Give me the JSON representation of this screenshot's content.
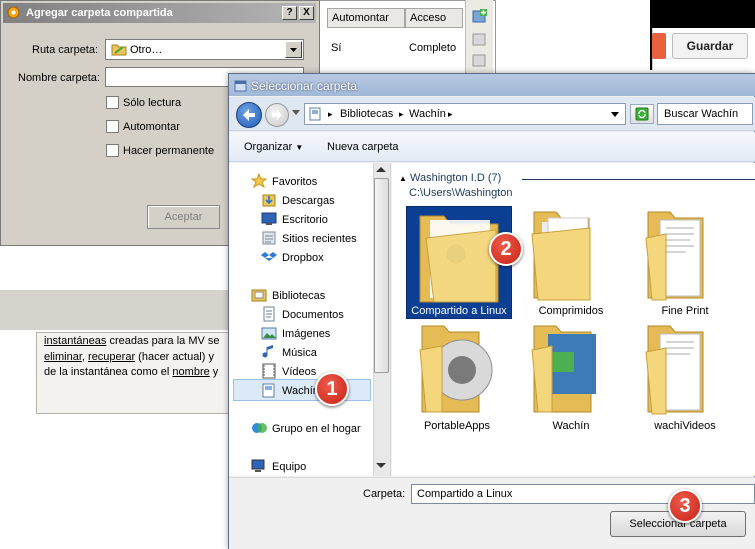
{
  "background": {
    "guardar_label": "Guardar",
    "grid_headers": [
      "Automontar",
      "Acceso"
    ],
    "grid_row": {
      "automontar": "Sí",
      "acceso": "Completo"
    },
    "panel_text": {
      "line1_link": "instantáneas",
      "line1_rest": " creadas para la MV se",
      "line2_link1": "eliminar",
      "line2_sep": ", ",
      "line2_link2": "recuperar",
      "line2_rest": " (hacer actual) y",
      "line3_pre": "de la instantánea como el ",
      "line3_link": "nombre",
      "line3_rest": " y"
    }
  },
  "dialog_agregar": {
    "title": "Agregar carpeta compartida",
    "help_btn": "?",
    "close_btn": "X",
    "ruta_label": "Ruta carpeta:",
    "ruta_value": "Otro…",
    "nombre_label": "Nombre carpeta:",
    "nombre_value": "",
    "solo_lectura": "Sólo lectura",
    "automontar": "Automontar",
    "permanente": "Hacer permanente",
    "aceptar": "Aceptar"
  },
  "dialog_select": {
    "title": "Seleccionar carpeta",
    "breadcrumb": [
      "Bibliotecas",
      "Wachín"
    ],
    "search_placeholder": "Buscar Wachín",
    "organize": "Organizar",
    "new_folder": "Nueva carpeta",
    "nav": {
      "favorites": "Favoritos",
      "downloads": "Descargas",
      "desktop": "Escritorio",
      "recent": "Sitios recientes",
      "dropbox": "Dropbox",
      "libraries": "Bibliotecas",
      "documents": "Documentos",
      "images": "Imágenes",
      "music": "Música",
      "videos": "Vídeos",
      "wachin": "Wachín",
      "homegroup": "Grupo en el hogar",
      "computer": "Equipo"
    },
    "group_header": "Washington I.D (7)",
    "group_path": "C:\\Users\\Washington",
    "folders": [
      "Compartido a Linux",
      "Comprimidos",
      "Fine Print",
      "PortableApps",
      "Wachín",
      "wachiVideos"
    ],
    "carpeta_label": "Carpeta:",
    "carpeta_value": "Compartido a Linux",
    "select_button": "Seleccionar carpeta"
  },
  "badges": [
    "1",
    "2",
    "3"
  ],
  "colors": {
    "selection": "#0b3f93",
    "badge": "#d6392a",
    "folder": "#f2d27a",
    "title_bar": "#a8bedb"
  }
}
